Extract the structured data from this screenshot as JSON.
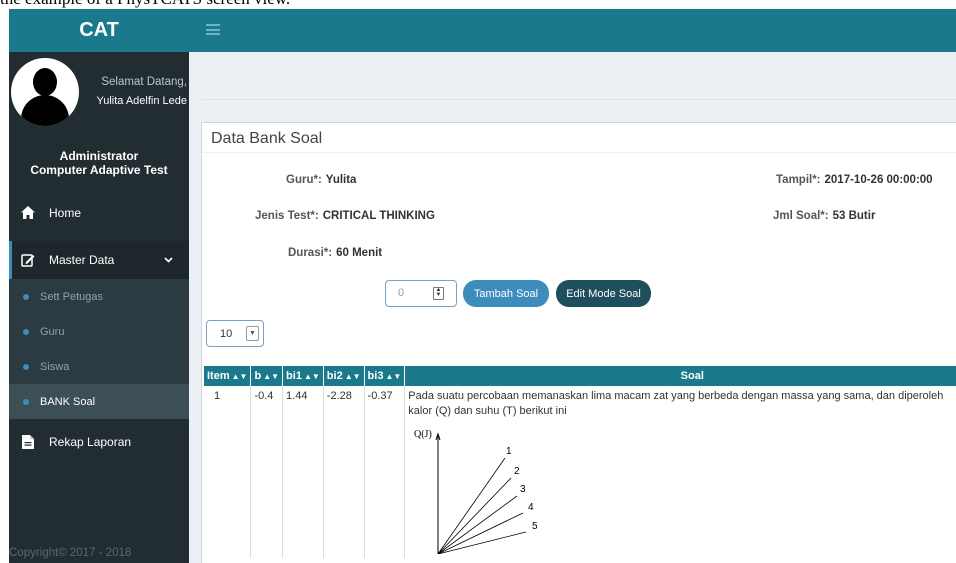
{
  "caption": "the example of a PhysTCATS screen view.",
  "sidebar": {
    "brand": "CAT",
    "greeting": "Selamat Datang,",
    "user_name": "Yulita Adelfin Lede",
    "role_line1": "Administrator",
    "role_line2": "Computer Adaptive Test",
    "menu": {
      "home": "Home",
      "master_data": "Master Data",
      "sub": [
        "Sett Petugas",
        "Guru",
        "Siswa",
        "BANK Soal"
      ],
      "rekap": "Rekap Laporan"
    },
    "copyright": "Copyright© 2017 - 2018"
  },
  "box": {
    "title": "Data Bank Soal",
    "fields": {
      "guru_label": "Guru*:",
      "guru_value": "Yulita",
      "tampil_label": "Tampil*:",
      "tampil_value": "2017-10-26 00:00:00",
      "jenis_label": "Jenis Test*:",
      "jenis_value": "CRITICAL THINKING",
      "jml_label": "Jml Soal*:",
      "jml_value": "53 Butir",
      "durasi_label": "Durasi*:",
      "durasi_value": "60 Menit"
    },
    "spinner_value": "0",
    "add_button": "Tambah Soal",
    "edit_button": "Edit Mode Soal",
    "page_size": "10"
  },
  "table": {
    "headers": [
      "Item",
      "b",
      "bi1",
      "bi2",
      "bi3",
      "Soal"
    ],
    "rows": [
      {
        "item": "1",
        "b": "-0.4",
        "bi1": "1.44",
        "bi2": "-2.28",
        "bi3": "-0.37",
        "soal_line1": "Pada suatu percobaan memanaskan lima macam zat yang berbeda dengan massa yang sama, dan diperoleh",
        "soal_line2": "kalor (Q) dan suhu (T) berikut ini"
      }
    ]
  },
  "figure": {
    "y_label": "Q(J)",
    "line_labels": [
      "1",
      "2",
      "3",
      "4",
      "5"
    ]
  },
  "colors": {
    "teal": "#1a7a8c",
    "sidebar": "#222d32",
    "primary": "#3c8dbc",
    "dark_button": "#1f4e5c"
  }
}
